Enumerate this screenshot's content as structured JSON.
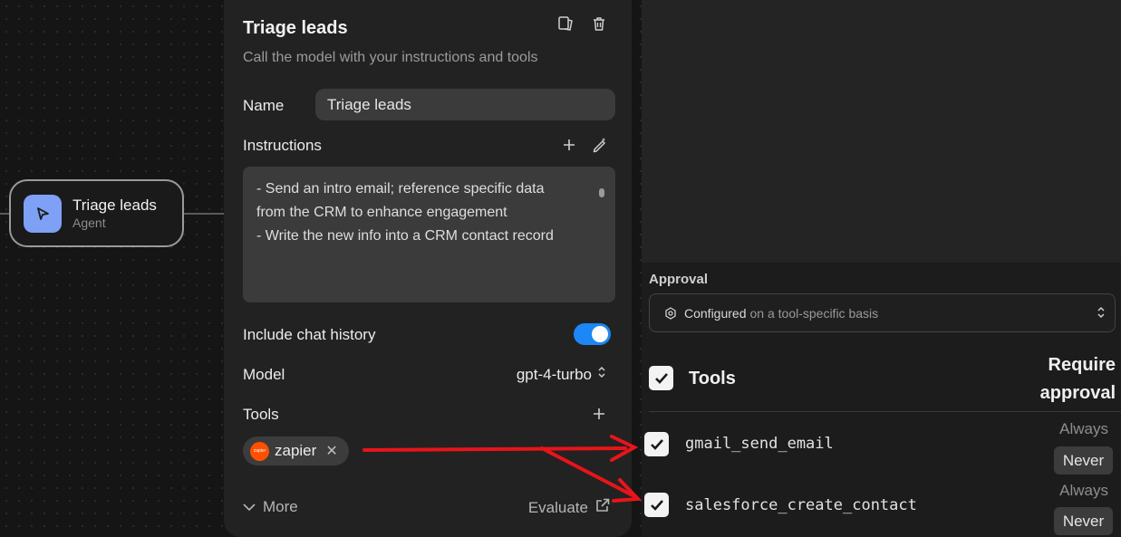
{
  "canvas": {
    "node": {
      "title": "Triage leads",
      "subtitle": "Agent",
      "icon": "cursor-arrow-icon"
    }
  },
  "panel": {
    "title": "Triage leads",
    "subtitle": "Call the model with your instructions and tools",
    "header_icons": [
      "copy-icon",
      "trash-icon"
    ],
    "name": {
      "label": "Name",
      "value": "Triage leads"
    },
    "instructions": {
      "label": "Instructions",
      "lines": [
        "- Send an intro email; reference specific data",
        "from the CRM to enhance engagement",
        "- Write the new info into a CRM contact record"
      ]
    },
    "chat_history": {
      "label": "Include chat history",
      "enabled": true
    },
    "model": {
      "label": "Model",
      "value": "gpt-4-turbo"
    },
    "tools": {
      "label": "Tools",
      "chips": [
        {
          "label": "zapier",
          "logo_text": "zapier",
          "icon": "zapier-logo"
        }
      ]
    },
    "more_label": "More",
    "evaluate_label": "Evaluate"
  },
  "approval": {
    "label": "Approval",
    "select_strong": "Configured",
    "select_muted": "on a tool-specific basis",
    "tools_header": "Tools",
    "require_header_line1": "Require",
    "require_header_line2": "approval",
    "tools": [
      {
        "name": "gmail_send_email",
        "checked": true,
        "always": "Always",
        "never": "Never",
        "selected": "Never"
      },
      {
        "name": "salesforce_create_contact",
        "checked": true,
        "always": "Always",
        "never": "Never",
        "selected": "Never"
      }
    ]
  },
  "colors": {
    "accent_toggle": "#1d87f5",
    "node_icon": "#7ea1f5",
    "zapier": "#ff4f00",
    "annotation_arrow": "#e8141a"
  }
}
